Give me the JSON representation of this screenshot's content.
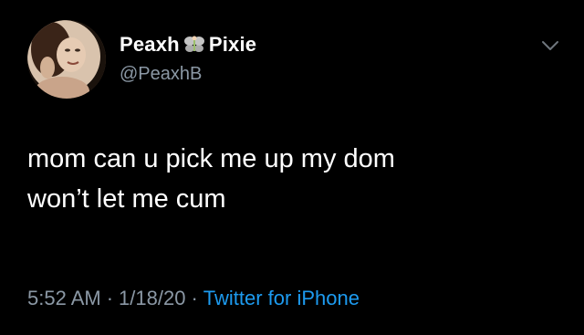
{
  "tweet": {
    "display_name_left": "Peaxh",
    "display_name_right": "Pixie",
    "name_emoji_icon": "fairy-icon",
    "handle": "@PeaxhB",
    "text_line1": "mom can u pick me up my dom",
    "text_line2": "won’t let me cum",
    "time": "5:52 AM",
    "separator": "·",
    "date": "1/18/20",
    "source": "Twitter for iPhone",
    "menu_icon": "chevron-down-icon"
  },
  "colors": {
    "background": "#000000",
    "name": "#ffffff",
    "secondary_text": "#8b98a5",
    "link": "#1d9bf0"
  }
}
